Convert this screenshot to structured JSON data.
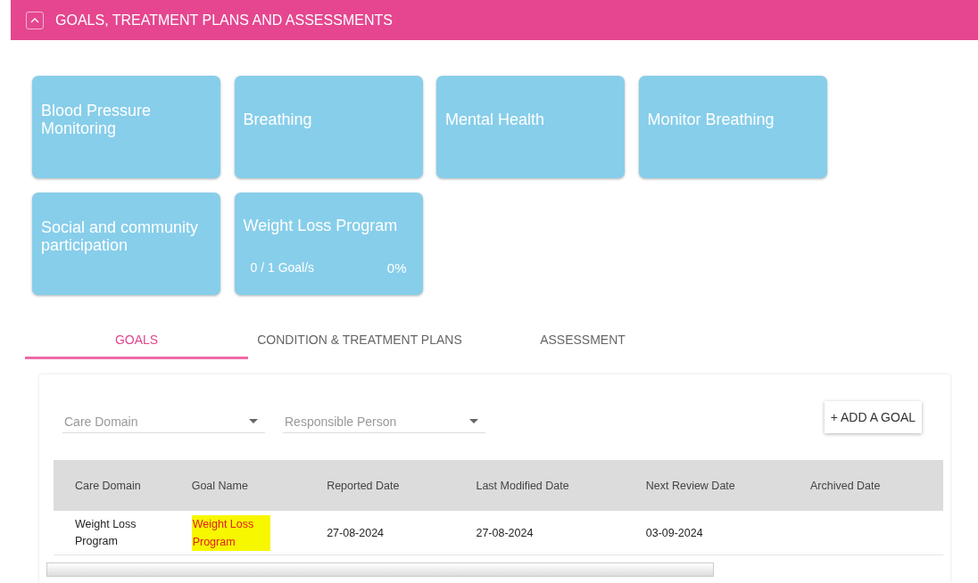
{
  "section": {
    "title": "GOALS, TREATMENT PLANS AND ASSESSMENTS",
    "expanded": true
  },
  "care_domain_cards": [
    {
      "title": "Blood Pressure Monitoring"
    },
    {
      "title": "Breathing"
    },
    {
      "title": "Mental Health"
    },
    {
      "title": "Monitor Breathing"
    },
    {
      "title": "Social and community participation"
    },
    {
      "title": "Weight Loss Program",
      "progress": "0 / 1 Goal/s",
      "percent": "0%"
    }
  ],
  "tabs": [
    {
      "label": "GOALS",
      "selected": true
    },
    {
      "label": "CONDITION & TREATMENT PLANS",
      "selected": false
    },
    {
      "label": "ASSESSMENT",
      "selected": false
    }
  ],
  "filters": [
    {
      "placeholder": "Care Domain"
    },
    {
      "placeholder": "Responsible Person"
    }
  ],
  "add_button": "+ ADD A GOAL",
  "table": {
    "columns": [
      "Care Domain",
      "Goal Name",
      "Reported Date",
      "Last Modified Date",
      "Next Review Date",
      "Archived Date"
    ],
    "rows": [
      {
        "care_domain": "Weight Loss Program",
        "goal_name": "Weight Loss Program",
        "goal_highlighted": true,
        "reported_date": "27-08-2024",
        "last_modified_date": "27-08-2024",
        "next_review_date": "03-09-2024"
      }
    ]
  }
}
